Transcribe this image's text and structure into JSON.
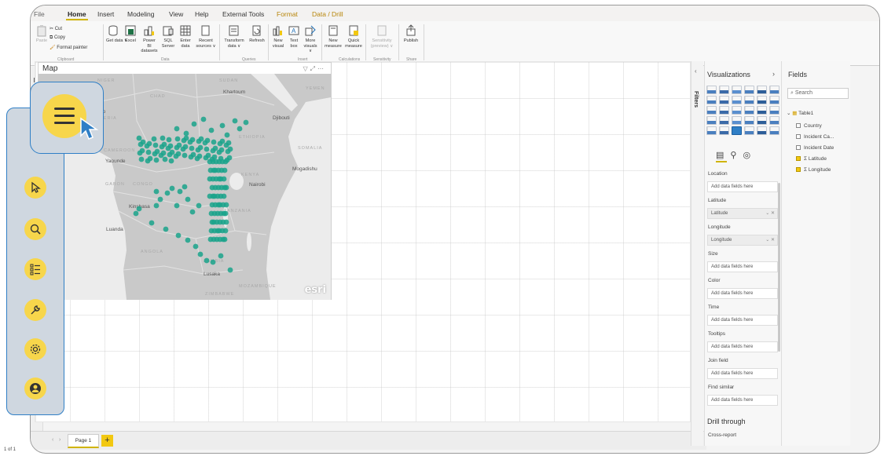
{
  "menu": [
    "File",
    "Home",
    "Insert",
    "Modeling",
    "View",
    "Help",
    "External Tools",
    "Format",
    "Data / Drill"
  ],
  "ribbon": {
    "clipboard": {
      "paste": "Paste",
      "cut": "Cut",
      "copy": "Copy",
      "format_painter": "Format painter",
      "group": "Clipboard"
    },
    "data": {
      "buttons": [
        "Get data ∨",
        "Excel",
        "Power BI datasets",
        "SQL Server",
        "Enter data",
        "Recent sources ∨"
      ],
      "group": "Data"
    },
    "queries": {
      "buttons": [
        "Transform data ∨",
        "Refresh"
      ],
      "group": "Queries"
    },
    "insert": {
      "buttons": [
        "New visual",
        "Text box",
        "More visuals ∨"
      ],
      "group": "Insert"
    },
    "calculations": {
      "buttons": [
        "New measure",
        "Quick measure"
      ],
      "group": "Calculations"
    },
    "sensitivity": {
      "buttons": [
        "Sensitivity (preview) ∨"
      ],
      "group": "Sensitivity"
    },
    "share": {
      "buttons": [
        "Publish"
      ],
      "group": "Share"
    }
  },
  "map_visual": {
    "title": "Map",
    "watermark": "esri",
    "labels": {
      "niger": "NIGER",
      "sudan": "SUDAN",
      "khartoum": "Khartoum",
      "chad": "CHAD",
      "yemen": "YEMEN",
      "kano": "Kano",
      "nigeria": "NIGERIA",
      "djibouti": "Djibouti",
      "ethiopia": "ETHIOPIA",
      "cameroon": "CAMEROON",
      "somalia": "SOMALIA",
      "yaounde": "Yaounde",
      "mogadishu": "Mogadishu",
      "gabon": "GABON",
      "congo": "CONGO",
      "kenya": "KENYA",
      "nairobi": "Nairobi",
      "kinshasa": "Kinshasa",
      "tanzania": "TANZANIA",
      "luanda": "Luanda",
      "angola": "ANGOLA",
      "zambia": "ZAMBIA",
      "lusaka": "Lusaka",
      "mozambique": "MOZAMBIQUE",
      "zimbabwe": "ZIMBABWE",
      "gos": "gos"
    }
  },
  "filters_label": "Filters",
  "visualizations": {
    "title": "Visualizations",
    "wells": [
      {
        "label": "Location",
        "value": "Add data fields here",
        "filled": false
      },
      {
        "label": "Latitude",
        "value": "Latitude",
        "filled": true
      },
      {
        "label": "Longitude",
        "value": "Longitude",
        "filled": true
      },
      {
        "label": "Size",
        "value": "Add data fields here",
        "filled": false
      },
      {
        "label": "Color",
        "value": "Add data fields here",
        "filled": false
      },
      {
        "label": "Time",
        "value": "Add data fields here",
        "filled": false
      },
      {
        "label": "Tooltips",
        "value": "Add data fields here",
        "filled": false
      },
      {
        "label": "Join field",
        "value": "Add data fields here",
        "filled": false
      },
      {
        "label": "Find similar",
        "value": "Add data fields here",
        "filled": false
      }
    ],
    "drill_title": "Drill through",
    "cross_report": "Cross-report"
  },
  "fields": {
    "title": "Fields",
    "search_placeholder": "Search",
    "table": "Table1",
    "items": [
      {
        "name": "Country",
        "checked": false,
        "sigma": false
      },
      {
        "name": "Incident Ca...",
        "checked": false,
        "sigma": false
      },
      {
        "name": "Incident Date",
        "checked": false,
        "sigma": false
      },
      {
        "name": "Latitude",
        "checked": true,
        "sigma": true
      },
      {
        "name": "Longitude",
        "checked": true,
        "sigma": true
      }
    ]
  },
  "pages": {
    "tab": "Page 1",
    "add": "+",
    "count": "1 of 1"
  },
  "colors": {
    "accent": "#f2c811",
    "points": "#1aa38b",
    "sidebar": "#cfd7e0",
    "sidebar_border": "#2f7fc6",
    "icon_bg": "#f7d64b"
  },
  "sidebar_icons": [
    "menu-icon",
    "pointer-icon",
    "search-icon",
    "checklist-icon",
    "wrench-icon",
    "gear-icon",
    "user-icon"
  ]
}
